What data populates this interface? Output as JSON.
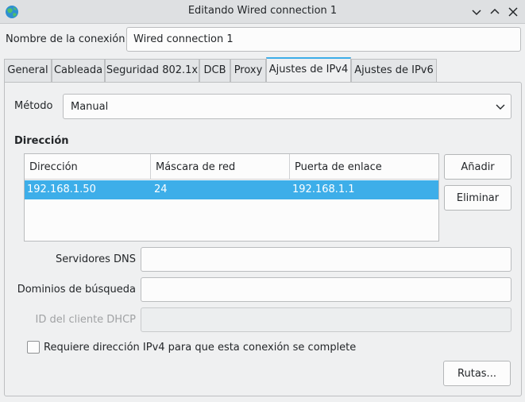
{
  "window": {
    "title": "Editando Wired connection 1",
    "icon": "network-globe-icon"
  },
  "connection_name": {
    "label": "Nombre de la conexión",
    "value": "Wired connection 1"
  },
  "tabs": [
    {
      "label": "General"
    },
    {
      "label": "Cableada"
    },
    {
      "label": "Seguridad 802.1x"
    },
    {
      "label": "DCB"
    },
    {
      "label": "Proxy"
    },
    {
      "label": "Ajustes de IPv4",
      "active": true
    },
    {
      "label": "Ajustes de IPv6"
    }
  ],
  "ipv4": {
    "method_label": "Método",
    "method_value": "Manual",
    "address_section_title": "Dirección",
    "columns": [
      "Dirección",
      "Máscara de red",
      "Puerta de enlace"
    ],
    "rows": [
      [
        "192.168.1.50",
        "24",
        "192.168.1.1"
      ]
    ],
    "add_button": "Añadir",
    "remove_button": "Eliminar",
    "dns_label": "Servidores DNS",
    "dns_value": "",
    "search_domains_label": "Dominios de búsqueda",
    "search_domains_value": "",
    "dhcp_client_id_label": "ID del cliente DHCP",
    "dhcp_client_id_value": "",
    "require_ipv4_label": "Requiere dirección IPv4 para que esta conexión se complete",
    "require_ipv4_checked": false,
    "routes_button": "Rutas..."
  },
  "colors": {
    "accent": "#3daee9",
    "background": "#eff0f1"
  }
}
